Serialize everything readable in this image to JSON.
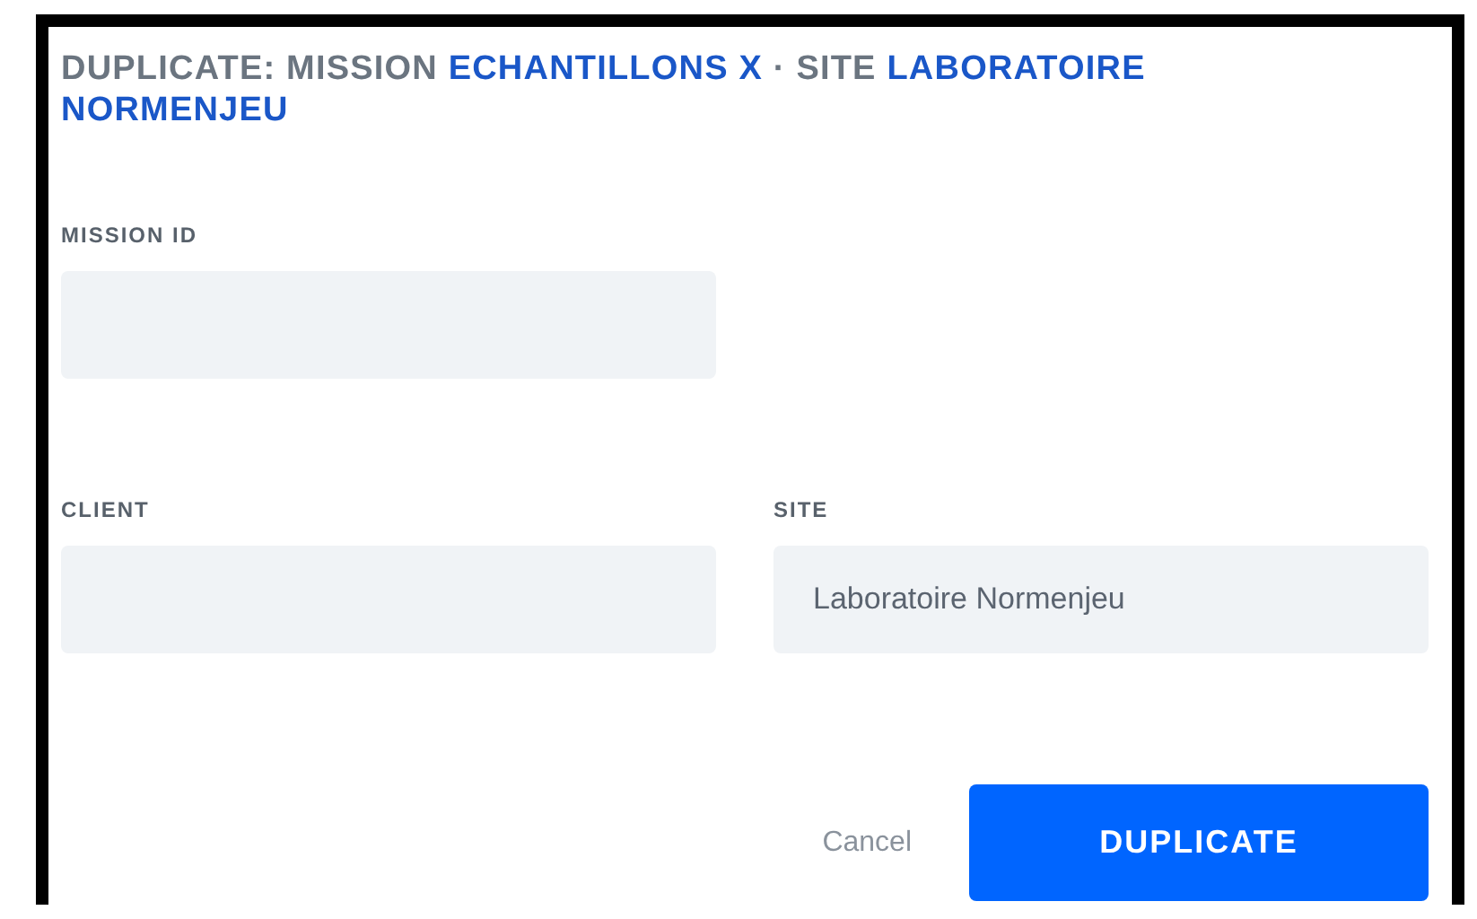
{
  "dialog": {
    "title": [
      {
        "text": "DUPLICATE: MISSION ",
        "highlight": false
      },
      {
        "text": "ECHANTILLONS X",
        "highlight": true
      },
      {
        "text": " · SITE ",
        "highlight": false
      },
      {
        "text": "LABORATOIRE NORMENJEU",
        "highlight": true
      }
    ],
    "fields": [
      {
        "label": "MISSION ID"
      },
      {
        "label": "CLIENT"
      },
      {
        "label": "SITE",
        "value": "Laboratoire Normenjeu"
      }
    ],
    "buttons": [
      {
        "label": "Cancel",
        "kind": "secondary"
      },
      {
        "label": "DUPLICATE",
        "kind": "primary"
      }
    ]
  }
}
